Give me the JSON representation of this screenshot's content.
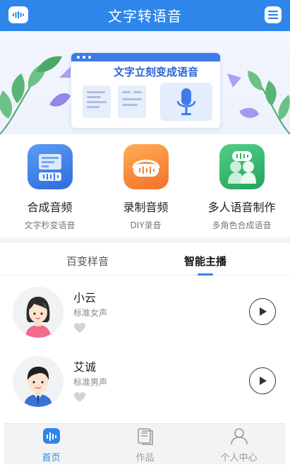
{
  "header": {
    "title": "文字转语音",
    "left_icon": "sound-wave-icon",
    "right_icon": "menu-icon",
    "color": "#2f86ea"
  },
  "banner": {
    "headline": "文字立刻变成语音",
    "icons": [
      "document-icon",
      "microphone-icon",
      "leaf-icon"
    ]
  },
  "features": [
    {
      "title": "合成音频",
      "subtitle": "文字秒变语音",
      "icon": "synthesize-audio-icon",
      "color": "#3a7be8"
    },
    {
      "title": "录制音频",
      "subtitle": "DIY录音",
      "icon": "record-audio-icon",
      "color": "#f5862b"
    },
    {
      "title": "多人语音制作",
      "subtitle": "多角色合成语音",
      "icon": "multi-voice-icon",
      "color": "#2fb36a"
    }
  ],
  "tabs": [
    {
      "label": "百变样音",
      "active": false
    },
    {
      "label": "智能主播",
      "active": true
    }
  ],
  "voices": [
    {
      "name": "小云",
      "desc": "标准女声",
      "avatar": "female-avatar-icon",
      "liked": false
    },
    {
      "name": "艾诚",
      "desc": "标准男声",
      "avatar": "male-avatar-icon",
      "liked": false
    }
  ],
  "bottom_nav": [
    {
      "label": "首页",
      "icon": "home-icon",
      "active": true
    },
    {
      "label": "作品",
      "icon": "works-icon",
      "active": false
    },
    {
      "label": "个人中心",
      "icon": "profile-icon",
      "active": false
    }
  ]
}
